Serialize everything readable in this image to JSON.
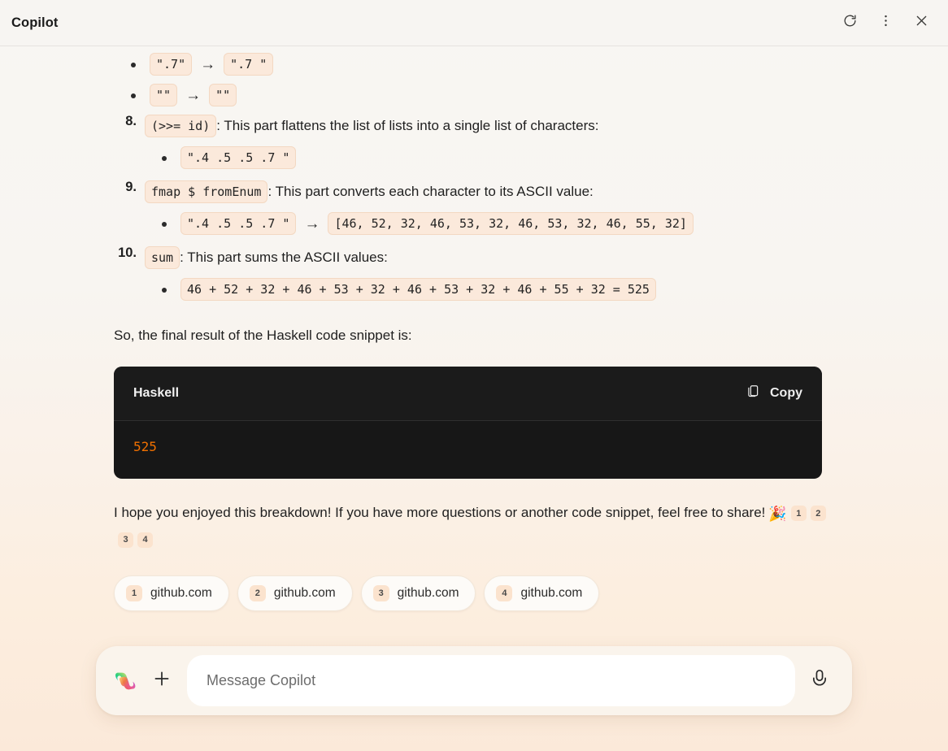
{
  "window": {
    "title": "Copilot",
    "actions": [
      {
        "name": "refresh-button",
        "label": "Refresh"
      },
      {
        "name": "more-options-button",
        "label": "More options"
      },
      {
        "name": "close-button",
        "label": "Close"
      }
    ]
  },
  "message": {
    "clipped_top_row": {
      "visible": true
    },
    "early_bullets": [
      {
        "from": "\".7\"",
        "arrow": "→",
        "to": "\".7 \""
      },
      {
        "from": "\"\"",
        "arrow": "→",
        "to": "\"\""
      }
    ],
    "steps": [
      {
        "number": "8.",
        "code": "(>>= id)",
        "text": ": This part flattens the list of lists into a single list of characters:",
        "bullets": [
          {
            "from": "\".4 .5 .5 .7 \"",
            "arrow": "",
            "to": ""
          }
        ]
      },
      {
        "number": "9.",
        "code": "fmap $ fromEnum",
        "text": ": This part converts each character to its ASCII value:",
        "bullets": [
          {
            "from": "\".4 .5 .5 .7 \"",
            "arrow": "→",
            "to": "[46, 52, 32, 46, 53, 32, 46, 53, 32, 46, 55, 32]"
          }
        ]
      },
      {
        "number": "10.",
        "code": "sum",
        "text": ": This part sums the ASCII values:",
        "bullets": [
          {
            "from": "46 + 52 + 32 + 46 + 53 + 32 + 46 + 53 + 32 + 46 + 55 + 32 = 525",
            "arrow": "",
            "to": ""
          }
        ]
      }
    ],
    "result_intro": "So, the final result of the Haskell code snippet is:",
    "code_block": {
      "language": "Haskell",
      "copy_label": "Copy",
      "content": "525",
      "accent_color": "#f07000"
    },
    "closing_text": "I hope you enjoyed this breakdown! If you have more questions or another code snippet, feel free to share!",
    "closing_emoji": "🎉",
    "inline_citations": [
      "1",
      "2",
      "3",
      "4"
    ]
  },
  "sources": [
    {
      "number": "1",
      "label": "github.com"
    },
    {
      "number": "2",
      "label": "github.com"
    },
    {
      "number": "3",
      "label": "github.com"
    },
    {
      "number": "4",
      "label": "github.com"
    }
  ],
  "composer": {
    "placeholder": "Message Copilot",
    "value": "",
    "add_label": "Add",
    "mic_label": "Voice input"
  },
  "colors": {
    "chip_bg": "#fbe9db",
    "chip_border": "#f3d8c2",
    "code_bg": "#171717",
    "code_accent": "#f07000",
    "citation_bg": "#fbe3ce"
  }
}
